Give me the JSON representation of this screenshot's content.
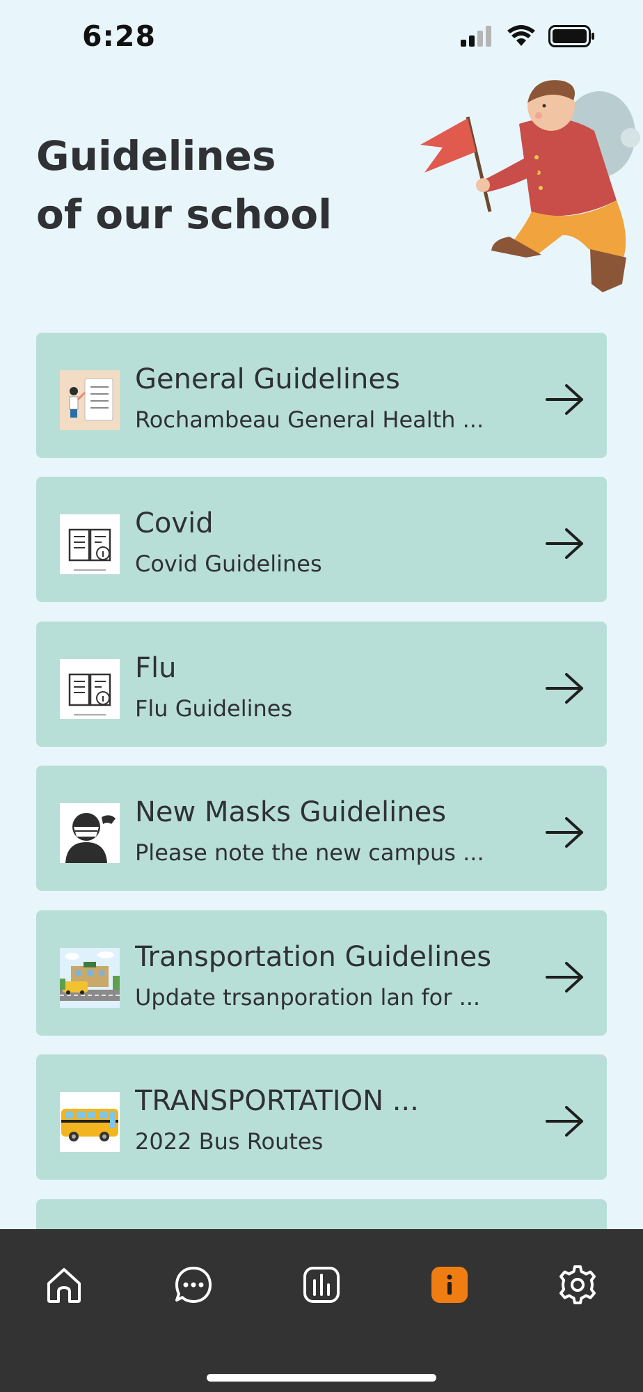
{
  "status": {
    "time": "6:28"
  },
  "header": {
    "title_line1": "Guidelines",
    "title_line2": "of our school"
  },
  "guidelines": [
    {
      "title": "General Guidelines",
      "subtitle": "Rochambeau General Health ..."
    },
    {
      "title": "Covid",
      "subtitle": "Covid Guidelines"
    },
    {
      "title": "Flu",
      "subtitle": "Flu Guidelines"
    },
    {
      "title": "New Masks Guidelines",
      "subtitle": "Please note the new campus ..."
    },
    {
      "title": "Transportation Guidelines",
      "subtitle": "Update trsanporation lan for ..."
    },
    {
      "title": "TRANSPORTATION ...",
      "subtitle": "2022 Bus Routes"
    }
  ],
  "tabs": [
    "home-icon",
    "chat-icon",
    "stats-icon",
    "info-icon",
    "settings-icon"
  ],
  "colors": {
    "background": "#e8f6fc",
    "card": "#b8dfd7",
    "tabbar": "#333333",
    "accent": "#f07d11"
  }
}
